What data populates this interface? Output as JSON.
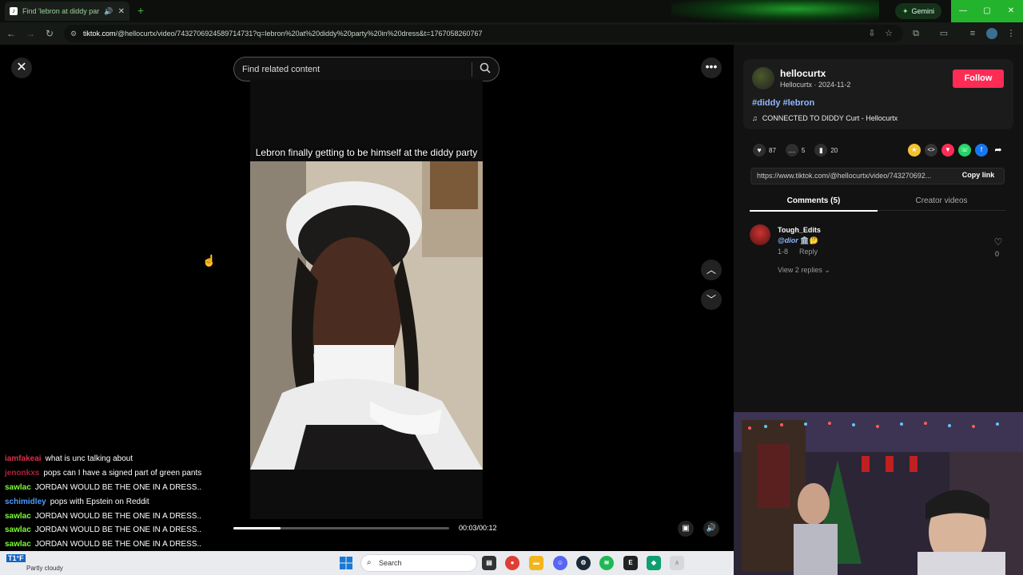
{
  "browser": {
    "tab_title": "Find 'lebron at diddy party",
    "gemini_label": "Gemini",
    "url_host": "tiktok.com",
    "url_path": "/@hellocurtx/video/7432706924589714731?q=lebron%20at%20diddy%20party%20in%20dress&t=1767058260767"
  },
  "page": {
    "search_placeholder": "Find related content",
    "video_caption": "Lebron finally getting to be himself at the diddy party",
    "time_display": "00:03/00:12",
    "progress_fraction": 0.22
  },
  "author": {
    "username": "hellocurtx",
    "subline": "Hellocurtx · 2024-11-2",
    "follow_label": "Follow",
    "hashtags": "#diddy #lebron",
    "music": "CONNECTED TO DIDDY Curt - Hellocurtx"
  },
  "stats": {
    "likes": "87",
    "comments": "5",
    "saves": "20"
  },
  "link": {
    "url": "https://www.tiktok.com/@hellocurtx/video/743270692...",
    "copy_label": "Copy link"
  },
  "tabs": {
    "comments": "Comments (5)",
    "creator": "Creator videos"
  },
  "comment": {
    "author": "Tough_Edits",
    "text": "@dior",
    "date": "1-8",
    "reply_label": "Reply",
    "view_replies": "View 2 replies",
    "likes": "0"
  },
  "chat": [
    {
      "user": "iamfakeai",
      "color": "#d9304c",
      "msg": "what is unc talking about"
    },
    {
      "user": "jenonkxs",
      "color": "#b0203a",
      "msg": "pops can I have a signed part of green pants"
    },
    {
      "user": "sawlac",
      "color": "#7cfc3a",
      "msg": "JORDAN WOULD BE THE ONE IN A DRESS.."
    },
    {
      "user": "schimidley",
      "color": "#4a9cff",
      "msg": "pops with Epstein on Reddit"
    },
    {
      "user": "sawlac",
      "color": "#7cfc3a",
      "msg": "JORDAN WOULD BE THE ONE IN A DRESS.."
    },
    {
      "user": "sawlac",
      "color": "#7cfc3a",
      "msg": "JORDAN WOULD BE THE ONE IN A DRESS.."
    },
    {
      "user": "sawlac",
      "color": "#7cfc3a",
      "msg": "JORDAN WOULD BE THE ONE IN A DRESS.."
    }
  ],
  "taskbar": {
    "weather_temp": "T1°F",
    "weather_desc": "Partly cloudy",
    "search_label": "Search"
  },
  "colors": {
    "follow": "#fe2c55",
    "accent_green": "#24b32c",
    "hashtag": "#8fb8ff"
  }
}
